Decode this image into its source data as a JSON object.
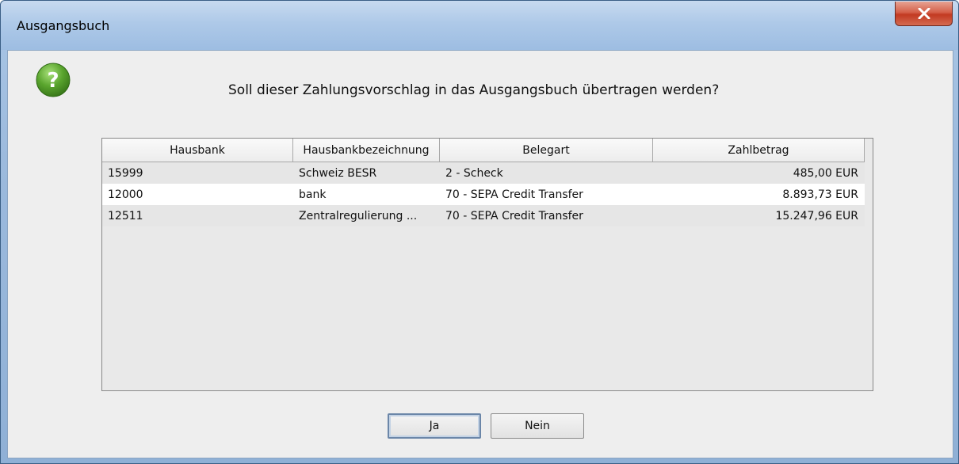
{
  "window": {
    "title": "Ausgangsbuch",
    "close_icon": "close-icon"
  },
  "dialog": {
    "icon": "question-icon",
    "message": "Soll dieser Zahlungsvorschlag in das Ausgangsbuch übertragen werden?"
  },
  "table": {
    "columns": [
      "Hausbank",
      "Hausbankbezeichnung",
      "Belegart",
      "Zahlbetrag"
    ],
    "rows": [
      [
        "15999",
        "Schweiz BESR",
        "2 - Scheck",
        "485,00 EUR"
      ],
      [
        "12000",
        "bank",
        "70 - SEPA Credit Transfer",
        "8.893,73 EUR"
      ],
      [
        "12511",
        "Zentralregulierung ...",
        "70 - SEPA Credit Transfer",
        "15.247,96 EUR"
      ]
    ]
  },
  "buttons": {
    "yes_label": "Ja",
    "no_label": "Nein"
  },
  "colors": {
    "title_bar": "#a7c4e4",
    "close_button": "#c8432a",
    "question_icon": "#5aa52e"
  }
}
